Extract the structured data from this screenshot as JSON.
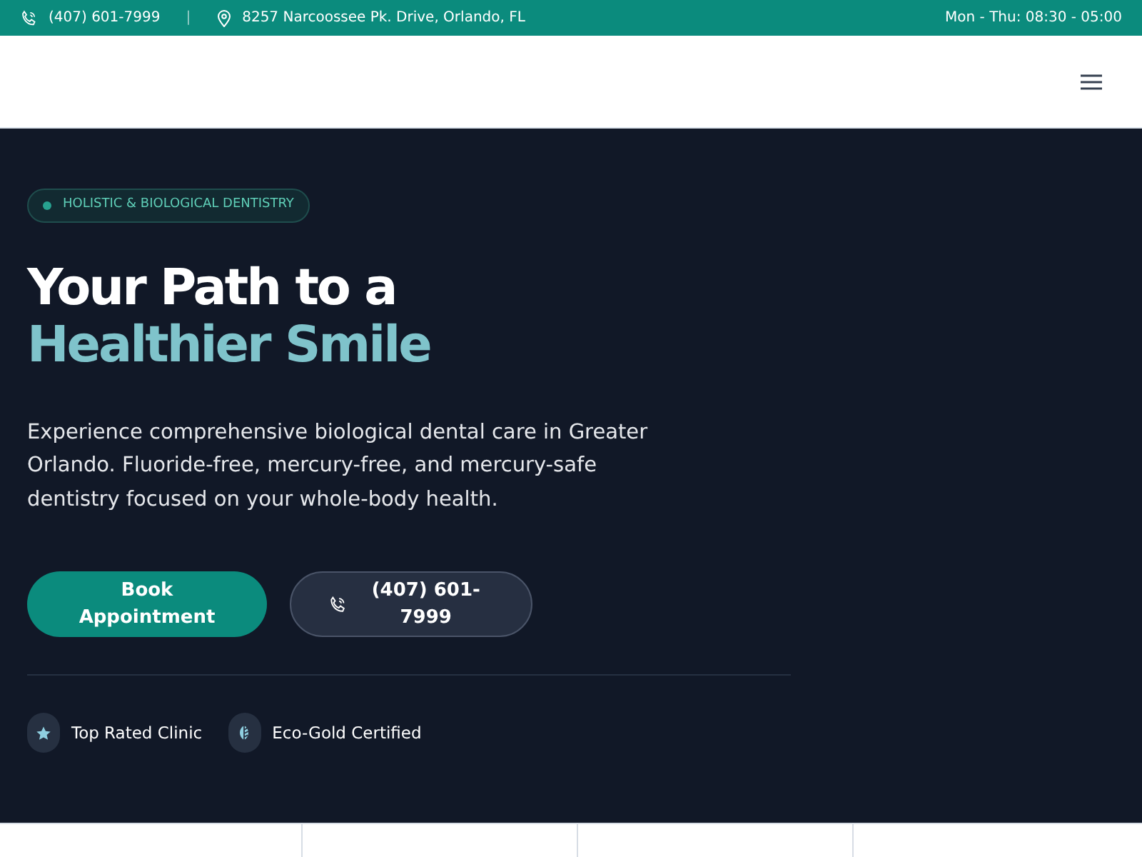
{
  "top_bar": {
    "phone": "(407) 601-7999",
    "separator": "|",
    "address": "8257 Narcoossee Pk. Drive, Orlando, FL",
    "hours": "Mon - Thu: 08:30 - 05:00"
  },
  "hero": {
    "tag": "HOLISTIC & BIOLOGICAL DENTISTRY",
    "title_line_1": "Your Path to a",
    "title_line_2": "Healthier Smile",
    "description": "Experience comprehensive biological dental care in Greater Orlando. Fluoride-free, mercury-free, and mercury-safe dentistry focused on your whole-body health.",
    "buttons": [
      {
        "kind": "primary",
        "label": "Book Appointment"
      },
      {
        "kind": "phone",
        "label": "(407) 601-7999"
      }
    ],
    "badges": [
      {
        "kind": "star",
        "label": "Top Rated Clinic"
      },
      {
        "kind": "leaf",
        "label": "Eco-Gold Certified"
      }
    ]
  }
}
